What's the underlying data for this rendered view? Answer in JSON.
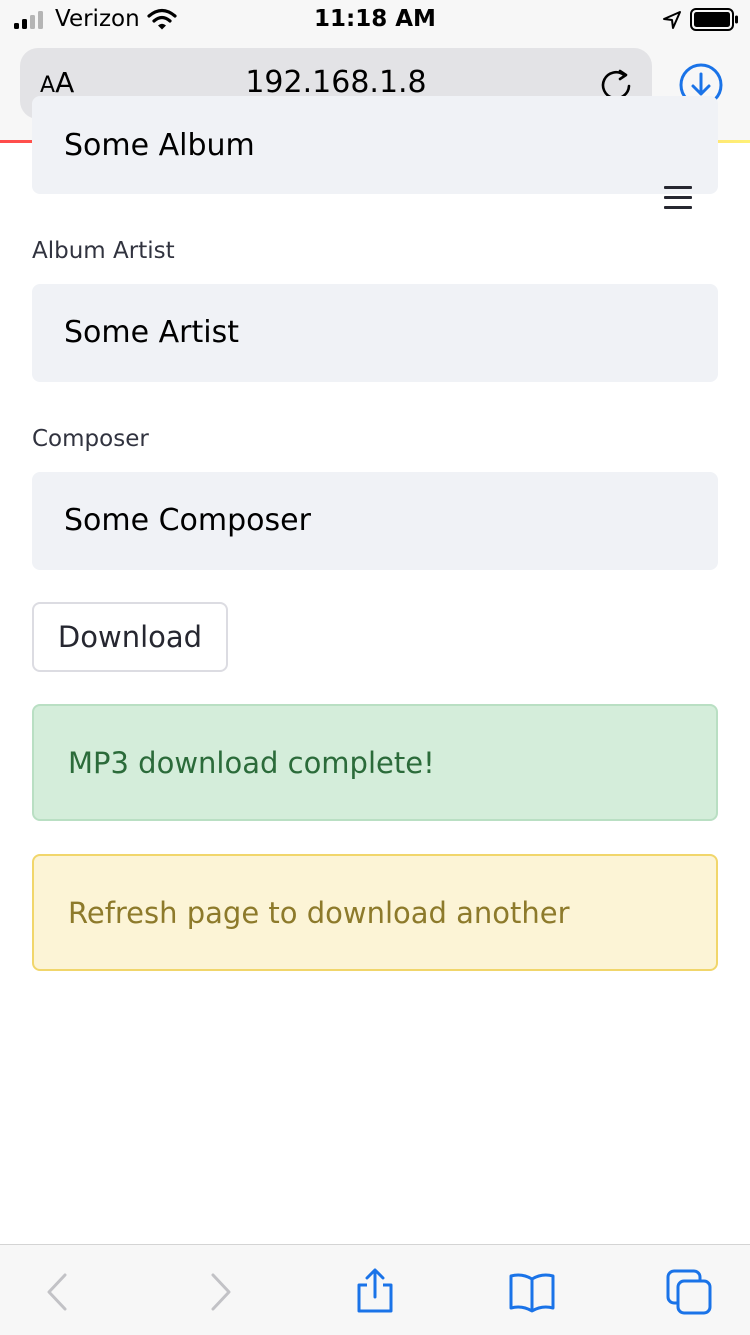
{
  "status_bar": {
    "carrier": "Verizon",
    "time": "11:18 AM"
  },
  "browser": {
    "aa_label_small": "A",
    "aa_label_large": "A",
    "url": "192.168.1.8"
  },
  "form": {
    "album_value": "Some Album",
    "album_artist_label": "Album Artist",
    "album_artist_value": "Some Artist",
    "composer_label": "Composer",
    "composer_value": "Some Composer",
    "download_button": "Download"
  },
  "alerts": {
    "success": "MP3 download complete!",
    "warning": "Refresh page to download another"
  },
  "colors": {
    "safari_blue": "#1a73e8",
    "success_bg": "#d4edda",
    "warning_bg": "#fcf4d6"
  }
}
